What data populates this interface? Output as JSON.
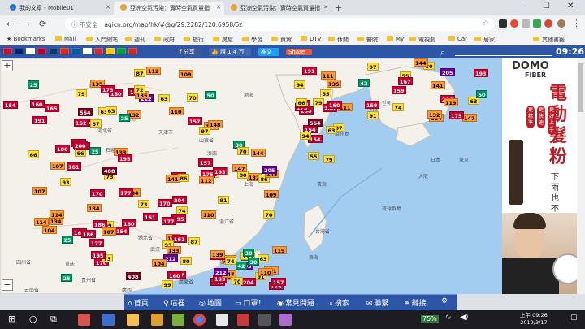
{
  "browser": {
    "tabs": [
      {
        "label": "我的文章 - Mobile01",
        "active": false
      },
      {
        "label": "亞洲空氣污染：實時空氣質量指",
        "active": true
      },
      {
        "label": "亞洲空氣污染：實時空氣質量指",
        "active": false
      }
    ],
    "new_tab_icon": "plus-icon",
    "security_label": "不安全",
    "url": "aqicn.org/map/hk/#@g/29.2282/120.6958/5z",
    "bookmarks": [
      "Bookmarks",
      "Mail",
      "入門網站",
      "週刊",
      "政府",
      "旅行",
      "房屋",
      "學習",
      "資實",
      "DTV",
      "休閒",
      "醫院",
      "My",
      "電視劇",
      "Car",
      "居家",
      "其他書籤"
    ]
  },
  "site": {
    "share_buttons": [
      "分享",
      "讚 1.4 万",
      "推文",
      "Share"
    ],
    "clock": "09:26",
    "flag_colors": [
      "#c8102e",
      "#012169",
      "#ffffff",
      "#bc002d",
      "#003478",
      "#de2910",
      "#0055a4",
      "#ffffff",
      "#ce2b37",
      "#ffcc00",
      "#009c3b",
      "#da251d"
    ]
  },
  "map": {
    "labels": [
      "內蒙古",
      "北京市",
      "天津市",
      "石家庄",
      "河北省",
      "濟南",
      "山東省",
      "西安",
      "四川省",
      "重庆",
      "湖北省",
      "武汉",
      "上海",
      "浙江省",
      "福建省",
      "台灣省",
      "廣東省",
      "廣西",
      "云南省",
      "贵州省",
      "日本",
      "한국",
      "서울",
      "東京",
      "大阪",
      "濟州島",
      "琉球群島",
      "渤海",
      "黃海",
      "東海"
    ],
    "markers": [
      {
        "v": "564",
        "c": "#7e0023"
      },
      {
        "v": "212",
        "c": "#660099"
      },
      {
        "v": "170",
        "c": "#cc0033"
      },
      {
        "v": "167",
        "c": "#cc0033"
      },
      {
        "v": "87",
        "c": "#ffde33"
      },
      {
        "v": "74",
        "c": "#ffde33"
      },
      {
        "v": "104",
        "c": "#ff9933"
      },
      {
        "v": "97",
        "c": "#ffde33"
      },
      {
        "v": "160",
        "c": "#cc0033"
      },
      {
        "v": "139",
        "c": "#ff9933"
      },
      {
        "v": "186",
        "c": "#cc0033"
      },
      {
        "v": "175",
        "c": "#cc0033"
      },
      {
        "v": "200",
        "c": "#cc0033"
      },
      {
        "v": "193",
        "c": "#cc0033"
      },
      {
        "v": "177",
        "c": "#cc0033"
      },
      {
        "v": "63",
        "c": "#ffde33"
      },
      {
        "v": "66",
        "c": "#ffde33"
      },
      {
        "v": "70",
        "c": "#ffde33"
      },
      {
        "v": "73",
        "c": "#ffde33"
      },
      {
        "v": "80",
        "c": "#ffde33"
      },
      {
        "v": "79",
        "c": "#ffde33"
      },
      {
        "v": "91",
        "c": "#ffde33"
      },
      {
        "v": "25",
        "c": "#009966"
      },
      {
        "v": "50",
        "c": "#009966"
      },
      {
        "v": "63",
        "c": "#ffde33"
      },
      {
        "v": "30",
        "c": "#009966"
      },
      {
        "v": "107",
        "c": "#ff9933"
      },
      {
        "v": "144",
        "c": "#ff9933"
      },
      {
        "v": "173",
        "c": "#cc0033"
      },
      {
        "v": "204",
        "c": "#cc0033"
      },
      {
        "v": "195",
        "c": "#cc0033"
      },
      {
        "v": "205",
        "c": "#660099"
      },
      {
        "v": "191",
        "c": "#cc0033"
      },
      {
        "v": "157",
        "c": "#cc0033"
      },
      {
        "v": "161",
        "c": "#cc0033"
      },
      {
        "v": "132",
        "c": "#ff9933"
      },
      {
        "v": "154",
        "c": "#cc0033"
      },
      {
        "v": "147",
        "c": "#ff9933"
      },
      {
        "v": "160",
        "c": "#cc0033"
      },
      {
        "v": "141",
        "c": "#ff9933"
      },
      {
        "v": "135",
        "c": "#ff9933"
      },
      {
        "v": "110",
        "c": "#ff9933"
      },
      {
        "v": "93",
        "c": "#ffde33"
      },
      {
        "v": "72",
        "c": "#ffde33"
      },
      {
        "v": "55",
        "c": "#ffde33"
      },
      {
        "v": "42",
        "c": "#009966"
      },
      {
        "v": "154",
        "c": "#cc0033"
      },
      {
        "v": "159",
        "c": "#cc0033"
      },
      {
        "v": "162",
        "c": "#cc0033"
      },
      {
        "v": "148",
        "c": "#ff9933"
      },
      {
        "v": "134",
        "c": "#ff9933"
      },
      {
        "v": "109",
        "c": "#ff9933"
      },
      {
        "v": "94",
        "c": "#ffde33"
      },
      {
        "v": "119",
        "c": "#ff9933"
      },
      {
        "v": "408",
        "c": "#7e0023"
      },
      {
        "v": "55",
        "c": "#ffde33"
      },
      {
        "v": "25",
        "c": "#009966"
      },
      {
        "v": "87",
        "c": "#ffde33"
      },
      {
        "v": "99",
        "c": "#ffde33"
      },
      {
        "v": "86",
        "c": "#ffde33"
      },
      {
        "v": "111",
        "c": "#ff9933"
      },
      {
        "v": "159",
        "c": "#cc0033"
      },
      {
        "v": "114",
        "c": "#ff9933"
      },
      {
        "v": "124",
        "c": "#ff9933"
      },
      {
        "v": "165",
        "c": "#cc0033"
      },
      {
        "v": "112",
        "c": "#ff9933"
      },
      {
        "v": "133",
        "c": "#ff9933"
      },
      {
        "v": "70",
        "c": "#ffde33"
      }
    ]
  },
  "ad": {
    "brand": "DOMO",
    "sub": "FIBER",
    "headline": "電動髮粉",
    "pills": [
      "更精準",
      "更快速",
      "更好上手"
    ],
    "tagline": "下雨也不掉色"
  },
  "bottom_nav": [
    {
      "label": "首頁",
      "icon": "home-icon"
    },
    {
      "label": "這裡",
      "icon": "location-icon"
    },
    {
      "label": "地圖",
      "icon": "map-icon"
    },
    {
      "label": "口罩！",
      "icon": "mask-icon"
    },
    {
      "label": "常見問題",
      "icon": "chat-icon"
    },
    {
      "label": "搜索",
      "icon": "search-icon"
    },
    {
      "label": "聯繫",
      "icon": "mail-icon"
    },
    {
      "label": "鏈接",
      "icon": "link-icon"
    },
    {
      "label": "",
      "icon": "gear-icon"
    }
  ],
  "taskbar": {
    "battery": "75%",
    "time": "上午 09:26",
    "date": "2019/3/17"
  }
}
